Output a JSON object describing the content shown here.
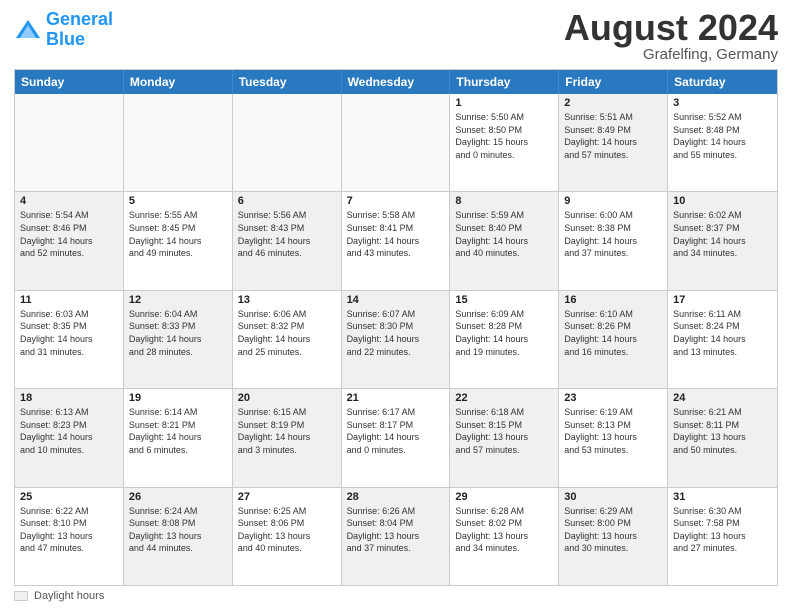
{
  "header": {
    "logo_line1": "General",
    "logo_line2": "Blue",
    "title": "August 2024",
    "location": "Grafelfing, Germany"
  },
  "weekdays": [
    "Sunday",
    "Monday",
    "Tuesday",
    "Wednesday",
    "Thursday",
    "Friday",
    "Saturday"
  ],
  "footer": {
    "legend_label": "Daylight hours"
  },
  "weeks": [
    [
      {
        "day": "",
        "info": "",
        "shaded": false
      },
      {
        "day": "",
        "info": "",
        "shaded": false
      },
      {
        "day": "",
        "info": "",
        "shaded": false
      },
      {
        "day": "",
        "info": "",
        "shaded": false
      },
      {
        "day": "1",
        "info": "Sunrise: 5:50 AM\nSunset: 8:50 PM\nDaylight: 15 hours\nand 0 minutes.",
        "shaded": false
      },
      {
        "day": "2",
        "info": "Sunrise: 5:51 AM\nSunset: 8:49 PM\nDaylight: 14 hours\nand 57 minutes.",
        "shaded": true
      },
      {
        "day": "3",
        "info": "Sunrise: 5:52 AM\nSunset: 8:48 PM\nDaylight: 14 hours\nand 55 minutes.",
        "shaded": false
      }
    ],
    [
      {
        "day": "4",
        "info": "Sunrise: 5:54 AM\nSunset: 8:46 PM\nDaylight: 14 hours\nand 52 minutes.",
        "shaded": true
      },
      {
        "day": "5",
        "info": "Sunrise: 5:55 AM\nSunset: 8:45 PM\nDaylight: 14 hours\nand 49 minutes.",
        "shaded": false
      },
      {
        "day": "6",
        "info": "Sunrise: 5:56 AM\nSunset: 8:43 PM\nDaylight: 14 hours\nand 46 minutes.",
        "shaded": true
      },
      {
        "day": "7",
        "info": "Sunrise: 5:58 AM\nSunset: 8:41 PM\nDaylight: 14 hours\nand 43 minutes.",
        "shaded": false
      },
      {
        "day": "8",
        "info": "Sunrise: 5:59 AM\nSunset: 8:40 PM\nDaylight: 14 hours\nand 40 minutes.",
        "shaded": true
      },
      {
        "day": "9",
        "info": "Sunrise: 6:00 AM\nSunset: 8:38 PM\nDaylight: 14 hours\nand 37 minutes.",
        "shaded": false
      },
      {
        "day": "10",
        "info": "Sunrise: 6:02 AM\nSunset: 8:37 PM\nDaylight: 14 hours\nand 34 minutes.",
        "shaded": true
      }
    ],
    [
      {
        "day": "11",
        "info": "Sunrise: 6:03 AM\nSunset: 8:35 PM\nDaylight: 14 hours\nand 31 minutes.",
        "shaded": false
      },
      {
        "day": "12",
        "info": "Sunrise: 6:04 AM\nSunset: 8:33 PM\nDaylight: 14 hours\nand 28 minutes.",
        "shaded": true
      },
      {
        "day": "13",
        "info": "Sunrise: 6:06 AM\nSunset: 8:32 PM\nDaylight: 14 hours\nand 25 minutes.",
        "shaded": false
      },
      {
        "day": "14",
        "info": "Sunrise: 6:07 AM\nSunset: 8:30 PM\nDaylight: 14 hours\nand 22 minutes.",
        "shaded": true
      },
      {
        "day": "15",
        "info": "Sunrise: 6:09 AM\nSunset: 8:28 PM\nDaylight: 14 hours\nand 19 minutes.",
        "shaded": false
      },
      {
        "day": "16",
        "info": "Sunrise: 6:10 AM\nSunset: 8:26 PM\nDaylight: 14 hours\nand 16 minutes.",
        "shaded": true
      },
      {
        "day": "17",
        "info": "Sunrise: 6:11 AM\nSunset: 8:24 PM\nDaylight: 14 hours\nand 13 minutes.",
        "shaded": false
      }
    ],
    [
      {
        "day": "18",
        "info": "Sunrise: 6:13 AM\nSunset: 8:23 PM\nDaylight: 14 hours\nand 10 minutes.",
        "shaded": true
      },
      {
        "day": "19",
        "info": "Sunrise: 6:14 AM\nSunset: 8:21 PM\nDaylight: 14 hours\nand 6 minutes.",
        "shaded": false
      },
      {
        "day": "20",
        "info": "Sunrise: 6:15 AM\nSunset: 8:19 PM\nDaylight: 14 hours\nand 3 minutes.",
        "shaded": true
      },
      {
        "day": "21",
        "info": "Sunrise: 6:17 AM\nSunset: 8:17 PM\nDaylight: 14 hours\nand 0 minutes.",
        "shaded": false
      },
      {
        "day": "22",
        "info": "Sunrise: 6:18 AM\nSunset: 8:15 PM\nDaylight: 13 hours\nand 57 minutes.",
        "shaded": true
      },
      {
        "day": "23",
        "info": "Sunrise: 6:19 AM\nSunset: 8:13 PM\nDaylight: 13 hours\nand 53 minutes.",
        "shaded": false
      },
      {
        "day": "24",
        "info": "Sunrise: 6:21 AM\nSunset: 8:11 PM\nDaylight: 13 hours\nand 50 minutes.",
        "shaded": true
      }
    ],
    [
      {
        "day": "25",
        "info": "Sunrise: 6:22 AM\nSunset: 8:10 PM\nDaylight: 13 hours\nand 47 minutes.",
        "shaded": false
      },
      {
        "day": "26",
        "info": "Sunrise: 6:24 AM\nSunset: 8:08 PM\nDaylight: 13 hours\nand 44 minutes.",
        "shaded": true
      },
      {
        "day": "27",
        "info": "Sunrise: 6:25 AM\nSunset: 8:06 PM\nDaylight: 13 hours\nand 40 minutes.",
        "shaded": false
      },
      {
        "day": "28",
        "info": "Sunrise: 6:26 AM\nSunset: 8:04 PM\nDaylight: 13 hours\nand 37 minutes.",
        "shaded": true
      },
      {
        "day": "29",
        "info": "Sunrise: 6:28 AM\nSunset: 8:02 PM\nDaylight: 13 hours\nand 34 minutes.",
        "shaded": false
      },
      {
        "day": "30",
        "info": "Sunrise: 6:29 AM\nSunset: 8:00 PM\nDaylight: 13 hours\nand 30 minutes.",
        "shaded": true
      },
      {
        "day": "31",
        "info": "Sunrise: 6:30 AM\nSunset: 7:58 PM\nDaylight: 13 hours\nand 27 minutes.",
        "shaded": false
      }
    ]
  ]
}
